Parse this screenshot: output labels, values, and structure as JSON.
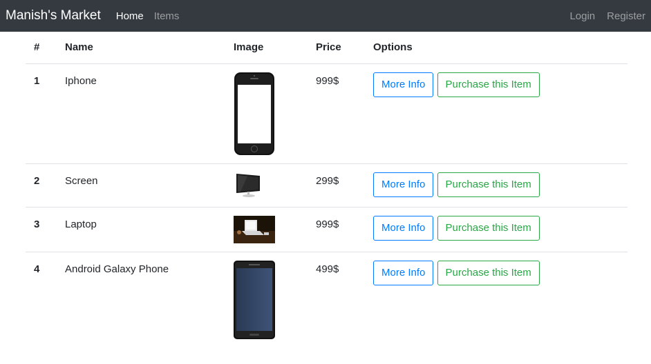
{
  "nav": {
    "brand": "Manish's Market",
    "links": [
      {
        "label": "Home"
      },
      {
        "label": "Items"
      }
    ],
    "right": [
      {
        "label": "Login"
      },
      {
        "label": "Register"
      }
    ]
  },
  "table": {
    "headers": [
      "#",
      "Name",
      "Image",
      "Price",
      "Options"
    ],
    "rows": [
      {
        "num": "1",
        "name": "Iphone",
        "price": "999$",
        "image_icon": "iphone-image"
      },
      {
        "num": "2",
        "name": "Screen",
        "price": "299$",
        "image_icon": "monitor-image"
      },
      {
        "num": "3",
        "name": "Laptop",
        "price": "999$",
        "image_icon": "laptop-image"
      },
      {
        "num": "4",
        "name": "Android Galaxy Phone",
        "price": "499$",
        "image_icon": "galaxy-phone-image"
      }
    ],
    "more_info_label": "More Info",
    "purchase_label": "Purchase this Item"
  },
  "colors": {
    "navbar": "#343a40",
    "info": "#007bff",
    "success": "#28a745"
  }
}
